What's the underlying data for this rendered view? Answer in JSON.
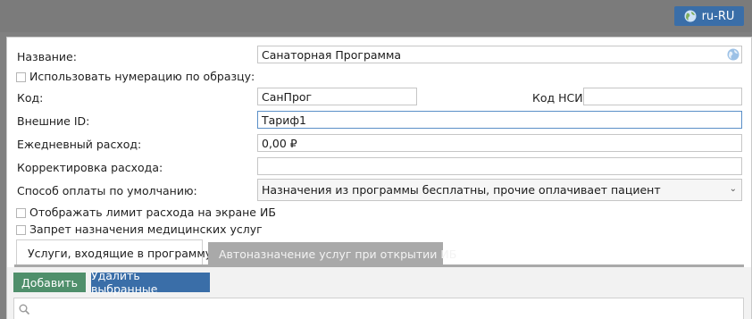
{
  "lang_button": {
    "label": "ru-RU"
  },
  "form": {
    "name": {
      "label": "Название:",
      "value": "Санаторная Программа"
    },
    "use_numbering": {
      "label": "Использовать нумерацию по образцу:"
    },
    "code": {
      "label": "Код:",
      "value": "СанПрог"
    },
    "nsi_code": {
      "label": "Код НСИ:",
      "value": ""
    },
    "external_id": {
      "label": "Внешние ID:",
      "value": "Тариф1"
    },
    "daily_expense": {
      "label": "Ежедневный расход:",
      "value": "0,00 ₽"
    },
    "expense_correction": {
      "label": "Корректировка расхода:",
      "value": ""
    },
    "payment_method": {
      "label": "Способ оплаты по умолчанию:",
      "value": "Назначения из программы бесплатны, прочие оплачивает пациент"
    },
    "show_limit": {
      "label": "Отображать лимит расхода на экране ИБ"
    },
    "ban_services": {
      "label": "Запрет назначения медицинских услуг"
    }
  },
  "tabs": [
    {
      "label": "Услуги, входящие в программу",
      "active": true
    },
    {
      "label": "Автоназначение услуг при открытии ИБ",
      "active": false
    }
  ],
  "toolbar": {
    "add_label": "Добавить",
    "delete_label": "Удалить выбранные"
  },
  "colors": {
    "add_button": "#4f8f6b",
    "delete_button": "#3a6ea8",
    "lang_button": "#3a6ea8"
  }
}
